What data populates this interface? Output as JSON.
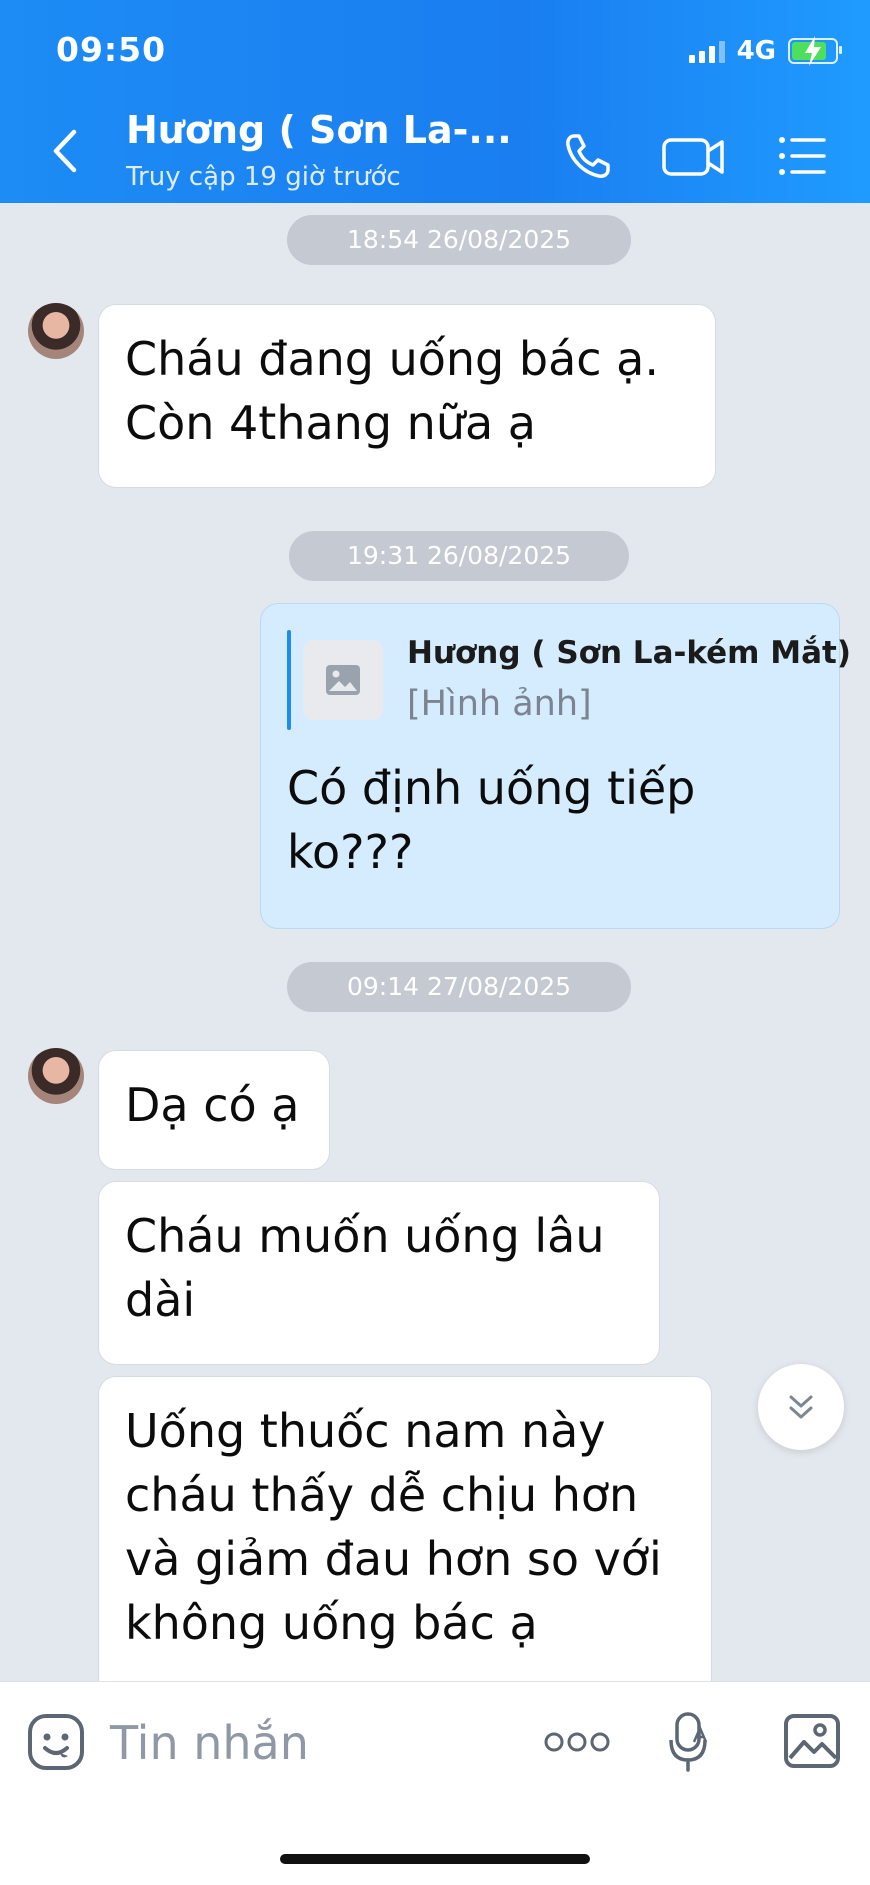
{
  "status": {
    "time": "09:50",
    "network": "4G"
  },
  "header": {
    "title": "Hương ( Sơn La-...",
    "subtitle": "Truy cập 19 giờ trước",
    "icons": [
      "back-chevron-icon",
      "phone-icon",
      "video-camera-icon",
      "menu-list-icon"
    ]
  },
  "messages": [
    {
      "type": "timestamp",
      "text": "18:54 26/08/2025"
    },
    {
      "type": "incoming",
      "text_lines": [
        "Cháu đang uống bác ạ.",
        "Còn 4thang nữa ạ"
      ]
    },
    {
      "type": "timestamp",
      "text": "19:31 26/08/2025"
    },
    {
      "type": "outgoing",
      "quote": {
        "name": "Hương ( Sơn La-kém Mắt)",
        "content": "[Hình ảnh]"
      },
      "text_lines": [
        "Có định uống tiếp",
        "ko???"
      ]
    },
    {
      "type": "timestamp",
      "text": "09:14 27/08/2025"
    },
    {
      "type": "incoming",
      "text_lines": [
        "Dạ có ạ"
      ]
    },
    {
      "type": "incoming",
      "text_lines": [
        "Cháu muốn uống lâu",
        "dài"
      ]
    },
    {
      "type": "incoming",
      "text_lines": [
        "Uống thuốc nam này",
        "cháu thấy dễ chịu hơn",
        "và giảm đau hơn so với",
        "không uống bác ạ"
      ]
    }
  ],
  "composer": {
    "placeholder": "Tin nhắn",
    "icons": [
      "emoji-icon",
      "more-dots-icon",
      "voice-to-text-icon",
      "image-icon"
    ]
  },
  "colors": {
    "header": "#1d8cf5",
    "outgoing_bubble": "#d4ecfd",
    "chat_background": "#e3e7ee"
  }
}
